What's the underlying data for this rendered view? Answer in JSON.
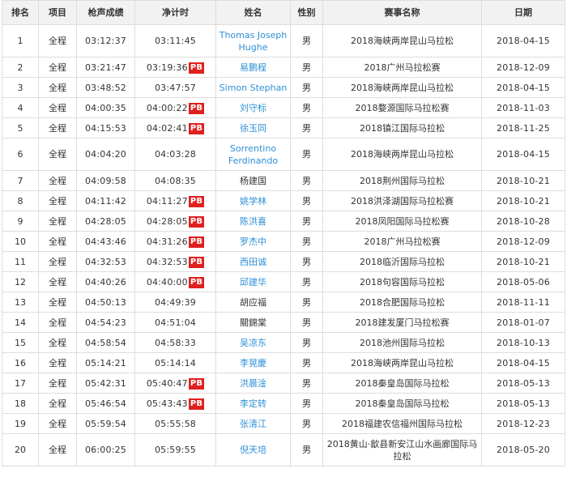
{
  "table": {
    "headers": {
      "rank": "排名",
      "event": "项目",
      "gun_time": "枪声成绩",
      "net_time": "净计时",
      "name": "姓名",
      "gender": "性别",
      "race": "赛事名称",
      "date": "日期"
    },
    "pb_label": "PB",
    "rows": [
      {
        "rank": "1",
        "event": "全程",
        "gun": "03:12:37",
        "net": "03:11:45",
        "pb": false,
        "name": "Thomas Joseph Hughe",
        "link": true,
        "gender": "男",
        "race": "2018海峡两岸昆山马拉松",
        "date": "2018-04-15"
      },
      {
        "rank": "2",
        "event": "全程",
        "gun": "03:21:47",
        "net": "03:19:36",
        "pb": true,
        "name": "易鹏程",
        "link": true,
        "gender": "男",
        "race": "2018广州马拉松赛",
        "date": "2018-12-09"
      },
      {
        "rank": "3",
        "event": "全程",
        "gun": "03:48:52",
        "net": "03:47:57",
        "pb": false,
        "name": "Simon Stephan",
        "link": true,
        "gender": "男",
        "race": "2018海峡两岸昆山马拉松",
        "date": "2018-04-15"
      },
      {
        "rank": "4",
        "event": "全程",
        "gun": "04:00:35",
        "net": "04:00:22",
        "pb": true,
        "name": "刘守标",
        "link": true,
        "gender": "男",
        "race": "2018婺源国际马拉松赛",
        "date": "2018-11-03"
      },
      {
        "rank": "5",
        "event": "全程",
        "gun": "04:15:53",
        "net": "04:02:41",
        "pb": true,
        "name": "徐玉同",
        "link": true,
        "gender": "男",
        "race": "2018镇江国际马拉松",
        "date": "2018-11-25"
      },
      {
        "rank": "6",
        "event": "全程",
        "gun": "04:04:20",
        "net": "04:03:28",
        "pb": false,
        "name": "Sorrentino Ferdinando",
        "link": true,
        "gender": "男",
        "race": "2018海峡两岸昆山马拉松",
        "date": "2018-04-15"
      },
      {
        "rank": "7",
        "event": "全程",
        "gun": "04:09:58",
        "net": "04:08:35",
        "pb": false,
        "name": "杨建国",
        "link": false,
        "gender": "男",
        "race": "2018荆州国际马拉松",
        "date": "2018-10-21"
      },
      {
        "rank": "8",
        "event": "全程",
        "gun": "04:11:42",
        "net": "04:11:27",
        "pb": true,
        "name": "姚学林",
        "link": true,
        "gender": "男",
        "race": "2018洪泽湖国际马拉松赛",
        "date": "2018-10-21"
      },
      {
        "rank": "9",
        "event": "全程",
        "gun": "04:28:05",
        "net": "04:28:05",
        "pb": true,
        "name": "陈洪喜",
        "link": true,
        "gender": "男",
        "race": "2018凤阳国际马拉松赛",
        "date": "2018-10-28"
      },
      {
        "rank": "10",
        "event": "全程",
        "gun": "04:43:46",
        "net": "04:31:26",
        "pb": true,
        "name": "罗杰中",
        "link": true,
        "gender": "男",
        "race": "2018广州马拉松赛",
        "date": "2018-12-09"
      },
      {
        "rank": "11",
        "event": "全程",
        "gun": "04:32:53",
        "net": "04:32:53",
        "pb": true,
        "name": "西田诚",
        "link": true,
        "gender": "男",
        "race": "2018临沂国际马拉松",
        "date": "2018-10-21"
      },
      {
        "rank": "12",
        "event": "全程",
        "gun": "04:40:26",
        "net": "04:40:00",
        "pb": true,
        "name": "邱建华",
        "link": true,
        "gender": "男",
        "race": "2018句容国际马拉松",
        "date": "2018-05-06"
      },
      {
        "rank": "13",
        "event": "全程",
        "gun": "04:50:13",
        "net": "04:49:39",
        "pb": false,
        "name": "胡应福",
        "link": false,
        "gender": "男",
        "race": "2018合肥国际马拉松",
        "date": "2018-11-11"
      },
      {
        "rank": "14",
        "event": "全程",
        "gun": "04:54:23",
        "net": "04:51:04",
        "pb": false,
        "name": "關錦棠",
        "link": false,
        "gender": "男",
        "race": "2018建发厦门马拉松赛",
        "date": "2018-01-07"
      },
      {
        "rank": "15",
        "event": "全程",
        "gun": "04:58:54",
        "net": "04:58:33",
        "pb": false,
        "name": "吴凉东",
        "link": true,
        "gender": "男",
        "race": "2018池州国际马拉松",
        "date": "2018-10-13"
      },
      {
        "rank": "16",
        "event": "全程",
        "gun": "05:14:21",
        "net": "05:14:14",
        "pb": false,
        "name": "李晃慶",
        "link": true,
        "gender": "男",
        "race": "2018海峡两岸昆山马拉松",
        "date": "2018-04-15"
      },
      {
        "rank": "17",
        "event": "全程",
        "gun": "05:42:31",
        "net": "05:40:47",
        "pb": true,
        "name": "洪晨淦",
        "link": true,
        "gender": "男",
        "race": "2018秦皇岛国际马拉松",
        "date": "2018-05-13"
      },
      {
        "rank": "18",
        "event": "全程",
        "gun": "05:46:54",
        "net": "05:43:43",
        "pb": true,
        "name": "李定转",
        "link": true,
        "gender": "男",
        "race": "2018秦皇岛国际马拉松",
        "date": "2018-05-13"
      },
      {
        "rank": "19",
        "event": "全程",
        "gun": "05:59:54",
        "net": "05:55:58",
        "pb": false,
        "name": "张清江",
        "link": true,
        "gender": "男",
        "race": "2018福建农信福州国际马拉松",
        "date": "2018-12-23"
      },
      {
        "rank": "20",
        "event": "全程",
        "gun": "06:00:25",
        "net": "05:59:55",
        "pb": false,
        "name": "倪天培",
        "link": true,
        "gender": "男",
        "race": "2018黄山·歙县新安江山水画廊国际马拉松",
        "date": "2018-05-20"
      }
    ]
  },
  "colors": {
    "link": "#2e8fd6",
    "pb_badge": "#e02020",
    "header_bg": "#f2f2f2",
    "border": "#dddddd"
  }
}
